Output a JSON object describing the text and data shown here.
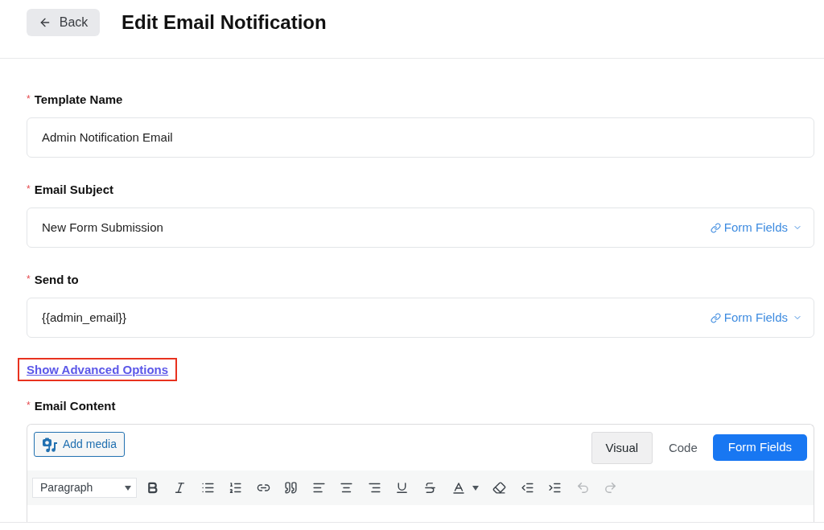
{
  "header": {
    "back_button": {
      "label": "Back"
    },
    "title": "Edit Email Notification"
  },
  "fields": [
    {
      "label": "Template Name",
      "required_mark": "*",
      "value": "Admin Notification Email"
    },
    {
      "label": "Email Subject",
      "required_mark": "*",
      "value": "New Form Submission",
      "insert_menu": "Form Fields"
    },
    {
      "label": "Send to",
      "required_mark": "*",
      "value": "{{admin_email}}",
      "insert_menu": "Form Fields"
    }
  ],
  "advanced_link": {
    "label": "Show Advanced Options",
    "highlighted": true
  },
  "content": {
    "label": "Email Content",
    "required_mark": "*",
    "add_media": "Add media",
    "mode_tabs": [
      {
        "label": "Visual",
        "selected": true
      },
      {
        "label": "Code",
        "selected": false
      }
    ],
    "form_fields_button": "Form Fields",
    "toolbar": {
      "block_format": "Paragraph",
      "history": [
        {
          "kind": "undo",
          "disabled": true
        },
        {
          "kind": "redo",
          "disabled": true
        }
      ]
    }
  }
}
